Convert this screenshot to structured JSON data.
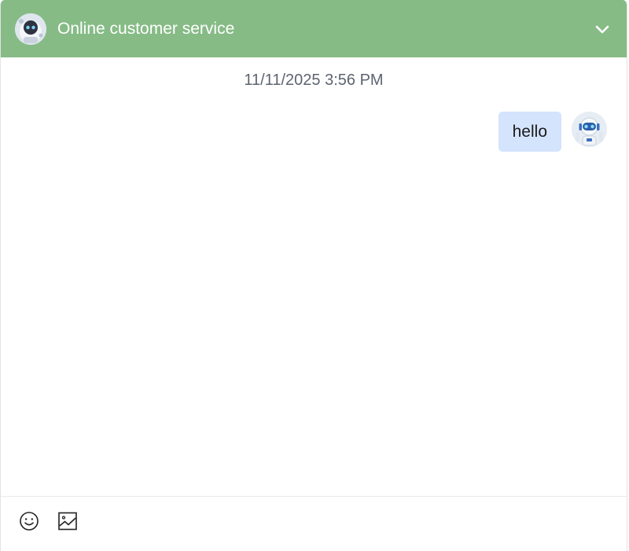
{
  "header": {
    "title": "Online customer service",
    "avatar_icon": "robot-avatar-icon",
    "collapse_icon": "chevron-down-icon",
    "background_color": "#86bb86"
  },
  "conversation": {
    "timestamp": "11/11/2025 3:56 PM",
    "messages": [
      {
        "sender": "user",
        "text": "hello",
        "avatar_icon": "robot-avatar-icon",
        "bubble_color": "#d4e4fd"
      }
    ]
  },
  "composer": {
    "tools": [
      {
        "name": "emoji",
        "icon": "smiley-icon"
      },
      {
        "name": "image",
        "icon": "image-icon"
      }
    ]
  }
}
